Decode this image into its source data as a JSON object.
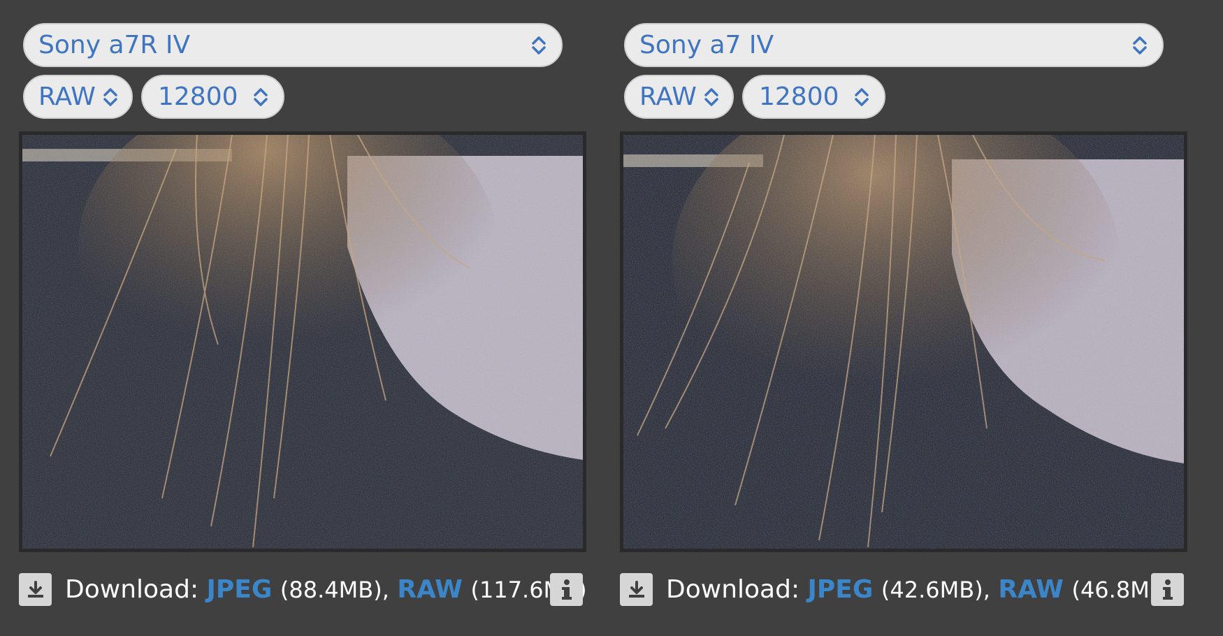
{
  "panes": [
    {
      "camera": "Sony a7R IV",
      "format": "RAW",
      "iso": "12800",
      "download": {
        "label": "Download:",
        "jpeg_label": "JPEG",
        "jpeg_size": "(88.4MB),",
        "raw_label": "RAW",
        "raw_size": "(117.6MB)"
      }
    },
    {
      "camera": "Sony a7 IV",
      "format": "RAW",
      "iso": "12800",
      "download": {
        "label": "Download:",
        "jpeg_label": "JPEG",
        "jpeg_size": "(42.6MB),",
        "raw_label": "RAW",
        "raw_size": "(46.8MB)"
      }
    }
  ],
  "icons": {
    "select": "chevron-up-down-icon",
    "download": "download-icon",
    "info": "info-icon"
  },
  "colors": {
    "background": "#404040",
    "select_text": "#3e74c2",
    "link": "#3b86c8"
  }
}
